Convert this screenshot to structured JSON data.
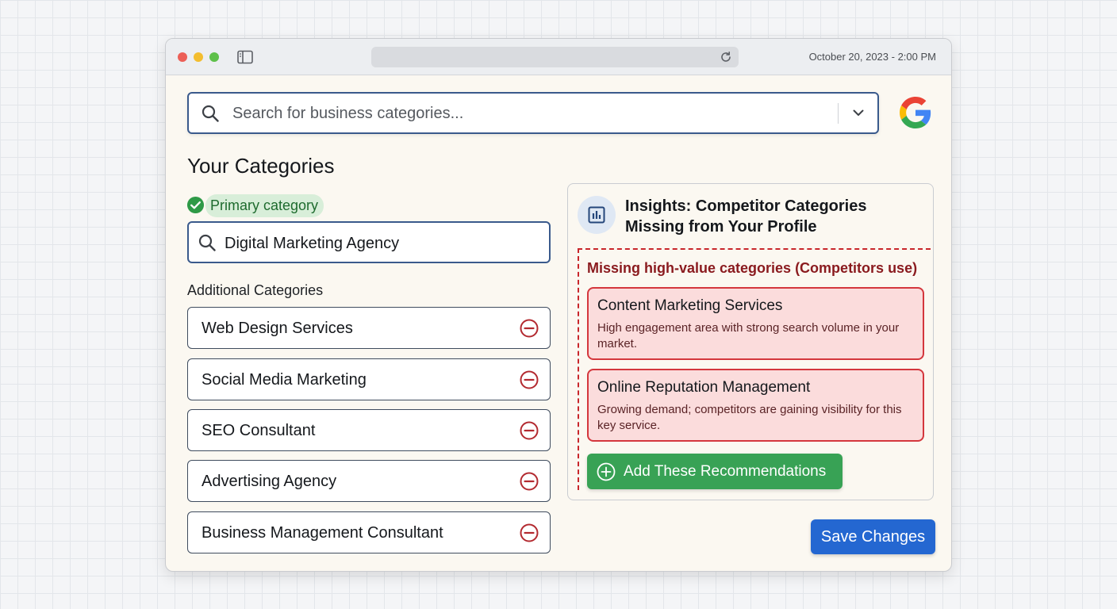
{
  "window": {
    "timestamp": "October 20, 2023 - 2:00 PM"
  },
  "search": {
    "placeholder": "Search for business categories..."
  },
  "categories": {
    "heading": "Your Categories",
    "primary_badge": "Primary category",
    "primary_value": "Digital Marketing Agency",
    "additional_label": "Additional Categories",
    "additional": [
      "Web Design Services",
      "Social Media Marketing",
      "SEO Consultant",
      "Advertising Agency",
      "Business Management Consultant"
    ]
  },
  "insights": {
    "title": "Insights: Competitor Categories Missing from Your Profile",
    "missing_label": "Missing high-value categories (Competitors use)",
    "recommendations": [
      {
        "title": "Content Marketing Services",
        "description": "High engagement area with strong search volume in your market."
      },
      {
        "title": "Online Reputation Management",
        "description": "Growing demand; competitors are gaining visibility for this key service."
      }
    ],
    "add_button": "Add These Recommendations"
  },
  "actions": {
    "save": "Save Changes"
  },
  "colors": {
    "accent_blue": "#2467d1",
    "success_green": "#38a255",
    "warning_red": "#d4373d"
  }
}
